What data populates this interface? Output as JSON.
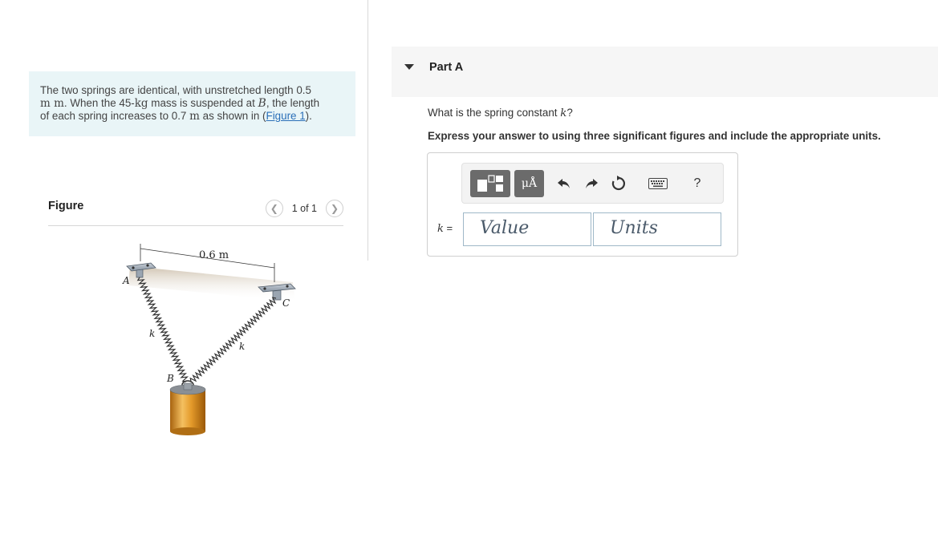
{
  "problem": {
    "t1": "The two springs are identical, with unstretched length 0.5",
    "t2_unit": "m m",
    "t2_text": ". When the 45-",
    "t2_kg": "kg",
    "t2_text2": " mass is suspended at ",
    "t2_B": "B",
    "t2_text3": ", the length",
    "t3_text": "of each spring increases to 0.7 ",
    "t3_unit": "m",
    "t3_text2": " as shown in (",
    "t3_link": "Figure 1",
    "t3_text3": ")."
  },
  "figure": {
    "title": "Figure",
    "pager_text": "1 of 1",
    "prev_icon": "chevron-left-icon",
    "next_icon": "chevron-right-icon",
    "dim_label": "0.6 m",
    "label_A": "A",
    "label_B": "B",
    "label_C": "C",
    "label_k_left": "k",
    "label_k_right": "k"
  },
  "part": {
    "title": "Part A",
    "question_text": "What is the spring constant ",
    "question_var": "k",
    "question_end": "?",
    "instruction": "Express your answer to using three significant figures and include the appropriate units."
  },
  "answer": {
    "var_name": "k",
    "var_eq": " =",
    "value_placeholder": "Value",
    "units_placeholder": "Units",
    "units_button": "μÅ",
    "help_button": "?"
  },
  "colors": {
    "problem_bg": "#e9f5f7",
    "link": "#2a6fb8",
    "part_header_bg": "#f6f6f6",
    "toolbar_dark": "#6b6b6b",
    "mass_gold": "#d89a2e"
  }
}
